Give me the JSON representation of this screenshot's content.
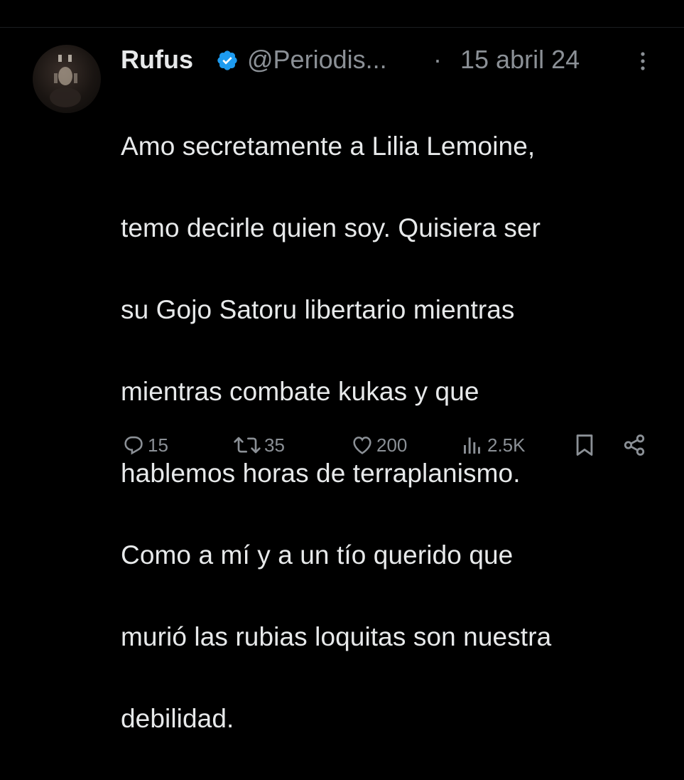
{
  "tweet": {
    "author_name": "Rufus",
    "handle": "@Periodis...",
    "separator": "·",
    "date": "15 abril 24",
    "text_lines": [
      "Amo secretamente a Lilia Lemoine,",
      "temo decirle quien soy. Quisiera ser",
      "su Gojo Satoru libertario mientras",
      "mientras combate kukas y que",
      "hablemos horas de terraplanismo.",
      "Como a mí y a un tío querido que",
      "murió las rubias loquitas son nuestra",
      "debilidad."
    ],
    "icons": {
      "verified": "verified-badge-icon",
      "more": "more-options-icon"
    },
    "colors": {
      "background": "#000000",
      "text": "#e7e9ea",
      "muted": "#8b9096",
      "verified": "#1d9bf0"
    }
  },
  "actions": {
    "replies": "15",
    "retweets": "35",
    "likes": "200",
    "views": "2.5K",
    "icons": [
      "reply-icon",
      "retweet-icon",
      "like-icon",
      "views-icon",
      "bookmark-icon",
      "share-icon"
    ]
  }
}
